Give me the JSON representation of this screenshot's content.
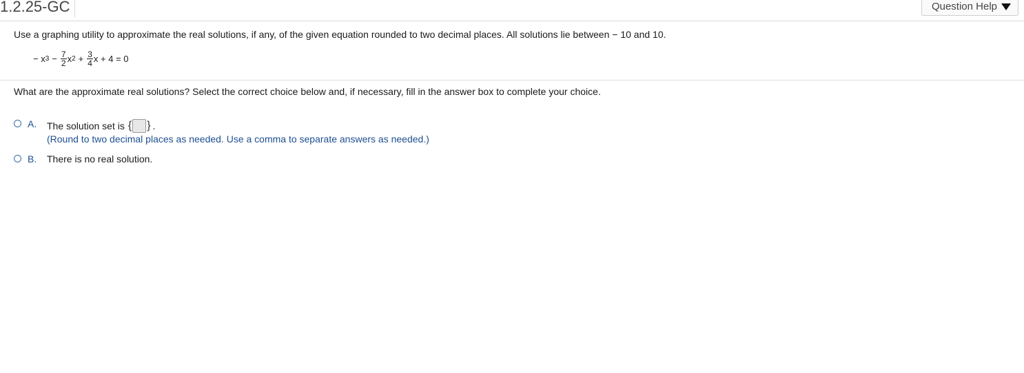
{
  "header": {
    "question_id": "1.2.25-GC",
    "help_label": "Question Help"
  },
  "problem": {
    "instructions": "Use a graphing utility to approximate the real solutions, if any, of the given equation rounded to two decimal places. All solutions lie between  − 10 and 10.",
    "equation": {
      "lead": "− x",
      "exp1": "3",
      "minus": "−",
      "frac1_num": "7",
      "frac1_den": "2",
      "x2": "x",
      "exp2": "2",
      "plus": "+",
      "frac2_num": "3",
      "frac2_den": "4",
      "tail": "x + 4 = 0"
    },
    "question": "What are the approximate real solutions? Select the correct choice below and, if necessary, fill in the answer box to complete your choice."
  },
  "choices": {
    "a": {
      "letter": "A.",
      "text": "The solution set is",
      "open_brace": "{",
      "close_brace": "}",
      "period": ".",
      "answer_value": "",
      "hint": "(Round to two decimal places as needed. Use a comma to separate answers as needed.)"
    },
    "b": {
      "letter": "B.",
      "text": "There is no real solution."
    }
  },
  "colors": {
    "accent": "#1d4f91",
    "radio_border": "#3a6ea5",
    "divider": "#e0e0e0"
  },
  "icons": {
    "help_caret": "caret-down-icon"
  }
}
